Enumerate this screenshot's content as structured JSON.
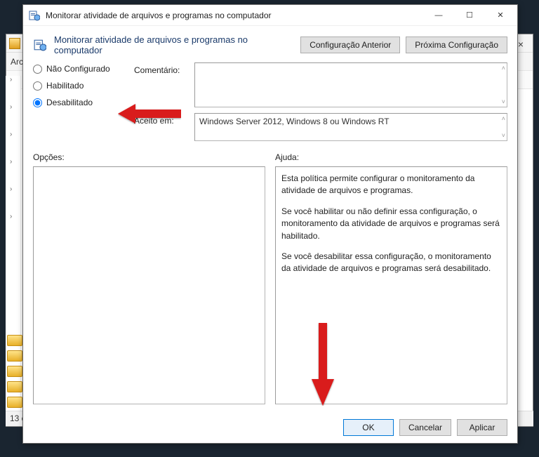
{
  "background": {
    "toolbar_label": "Arc",
    "status_text": "13 c",
    "close_glyph": "×"
  },
  "titlebar": {
    "title": "Monitorar atividade de arquivos e programas no computador",
    "minimize_glyph": "—",
    "maximize_glyph": "☐",
    "close_glyph": "✕"
  },
  "subheader": {
    "title": "Monitorar atividade de arquivos e programas no computador",
    "prev_btn": "Configuração Anterior",
    "next_btn": "Próxima Configuração"
  },
  "radios": {
    "not_configured": "Não Configurado",
    "enabled": "Habilitado",
    "disabled": "Desabilitado"
  },
  "fields": {
    "comment_label": "Comentário:",
    "comment_value": "",
    "accepted_label": "Aceito em:",
    "accepted_value": "Windows Server 2012, Windows 8 ou Windows RT"
  },
  "columns": {
    "options_label": "Opções:",
    "help_label": "Ajuda:",
    "help_text": {
      "p1": "Esta política permite configurar o monitoramento da atividade de arquivos e programas.",
      "p2": "Se você habilitar ou não definir essa configuração, o monitoramento da atividade de arquivos e programas será habilitado.",
      "p3": "Se você desabilitar essa configuração, o monitoramento da atividade de arquivos e programas será desabilitado."
    }
  },
  "footer": {
    "ok": "OK",
    "cancel": "Cancelar",
    "apply": "Aplicar"
  }
}
